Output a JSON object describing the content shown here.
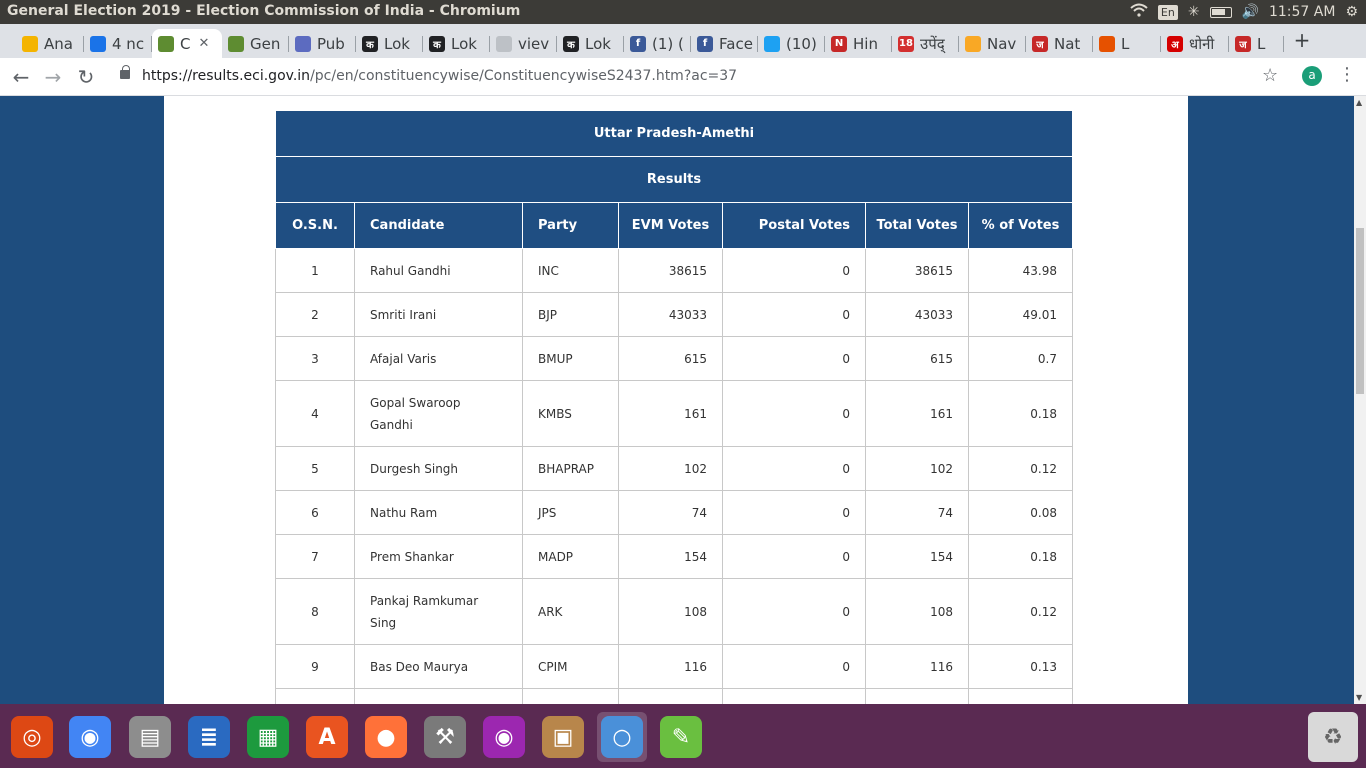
{
  "window": {
    "title": "General Election 2019 - Election Commission of India - Chromium",
    "tray": {
      "keyboard": "En",
      "clock": "11:57 AM"
    }
  },
  "tabs": [
    {
      "label": "Ana",
      "icon": "bar-chart-icon",
      "color": "#f4b400"
    },
    {
      "label": "4 nc",
      "icon": "chat-icon",
      "color": "#1a73e8"
    },
    {
      "label": "C",
      "icon": "pen-icon",
      "color": "#5e8c31",
      "active": true
    },
    {
      "label": "Gen",
      "icon": "pen-icon",
      "color": "#5e8c31"
    },
    {
      "label": "Pub",
      "icon": "globe-icon",
      "color": "#5c6bc0"
    },
    {
      "label": "Lok",
      "icon": "ka-icon",
      "color": "#202124",
      "glyph": "क"
    },
    {
      "label": "Lok",
      "icon": "ka-icon",
      "color": "#202124",
      "glyph": "क"
    },
    {
      "label": "viev",
      "icon": "page-icon",
      "color": "#bdc1c6"
    },
    {
      "label": "Lok",
      "icon": "ka-icon",
      "color": "#202124",
      "glyph": "क"
    },
    {
      "label": "(1) (",
      "icon": "facebook-icon",
      "color": "#3b5998",
      "glyph": "f"
    },
    {
      "label": "Face",
      "icon": "facebook-icon",
      "color": "#3b5998",
      "glyph": "f"
    },
    {
      "label": "(10)",
      "icon": "twitter-icon",
      "color": "#1da1f2"
    },
    {
      "label": "Hin",
      "icon": "news-icon",
      "color": "#c62828",
      "glyph": "N"
    },
    {
      "label": "उपेंद्",
      "icon": "news18-icon",
      "color": "#d32f2f",
      "glyph": "18"
    },
    {
      "label": "Nav",
      "icon": "sunrise-icon",
      "color": "#f9a825"
    },
    {
      "label": "Nat",
      "icon": "ja-icon",
      "color": "#c62828",
      "glyph": "ज"
    },
    {
      "label": "L",
      "icon": "circle-icon",
      "color": "#e65100"
    },
    {
      "label": "धोनी",
      "icon": "aa-icon",
      "color": "#d50000",
      "glyph": "अ"
    },
    {
      "label": "L",
      "icon": "ja-icon",
      "color": "#c62828",
      "glyph": "ज"
    }
  ],
  "address": {
    "host": "https://results.eci.gov.in",
    "path": "/pc/en/constituencywise/ConstituencywiseS2437.htm?ac=37"
  },
  "profile": {
    "initial": "a"
  },
  "results": {
    "title": "Uttar Pradesh-Amethi",
    "subtitle": "Results",
    "columns": [
      "O.S.N.",
      "Candidate",
      "Party",
      "EVM Votes",
      "Postal Votes",
      "Total Votes",
      "% of Votes"
    ],
    "rows": [
      {
        "osn": "1",
        "candidate": "Rahul Gandhi",
        "party": "INC",
        "evm": "38615",
        "postal": "0",
        "total": "38615",
        "pct": "43.98"
      },
      {
        "osn": "2",
        "candidate": "Smriti Irani",
        "party": "BJP",
        "evm": "43033",
        "postal": "0",
        "total": "43033",
        "pct": "49.01"
      },
      {
        "osn": "3",
        "candidate": "Afajal Varis",
        "party": "BMUP",
        "evm": "615",
        "postal": "0",
        "total": "615",
        "pct": "0.7"
      },
      {
        "osn": "4",
        "candidate": "Gopal Swaroop Gandhi",
        "party": "KMBS",
        "evm": "161",
        "postal": "0",
        "total": "161",
        "pct": "0.18"
      },
      {
        "osn": "5",
        "candidate": "Durgesh Singh",
        "party": "BHAPRAP",
        "evm": "102",
        "postal": "0",
        "total": "102",
        "pct": "0.12"
      },
      {
        "osn": "6",
        "candidate": "Nathu Ram",
        "party": "JPS",
        "evm": "74",
        "postal": "0",
        "total": "74",
        "pct": "0.08"
      },
      {
        "osn": "7",
        "candidate": "Prem Shankar",
        "party": "MADP",
        "evm": "154",
        "postal": "0",
        "total": "154",
        "pct": "0.18"
      },
      {
        "osn": "8",
        "candidate": "Pankaj Ramkumar Sing",
        "party": "ARK",
        "evm": "108",
        "postal": "0",
        "total": "108",
        "pct": "0.12"
      },
      {
        "osn": "9",
        "candidate": "Bas Deo Maurya",
        "party": "CPIM",
        "evm": "116",
        "postal": "0",
        "total": "116",
        "pct": "0.13"
      }
    ]
  },
  "dock": [
    {
      "name": "ubuntu-dash-icon",
      "color": "#dd4814"
    },
    {
      "name": "chrome-icon",
      "color": "#4285f4"
    },
    {
      "name": "files-icon",
      "color": "#8d8d8d"
    },
    {
      "name": "writer-icon",
      "color": "#2a6ac1"
    },
    {
      "name": "calc-icon",
      "color": "#1d9a3e"
    },
    {
      "name": "software-center-icon",
      "color": "#e95420"
    },
    {
      "name": "firefox-icon",
      "color": "#ff7139"
    },
    {
      "name": "settings-icon",
      "color": "#7a7a7a"
    },
    {
      "name": "eye-icon",
      "color": "#9c27b0"
    },
    {
      "name": "archive-icon",
      "color": "#b8864b"
    },
    {
      "name": "chromium-icon",
      "color": "#4a90d9",
      "active": true
    },
    {
      "name": "notes-icon",
      "color": "#6abf40"
    }
  ]
}
